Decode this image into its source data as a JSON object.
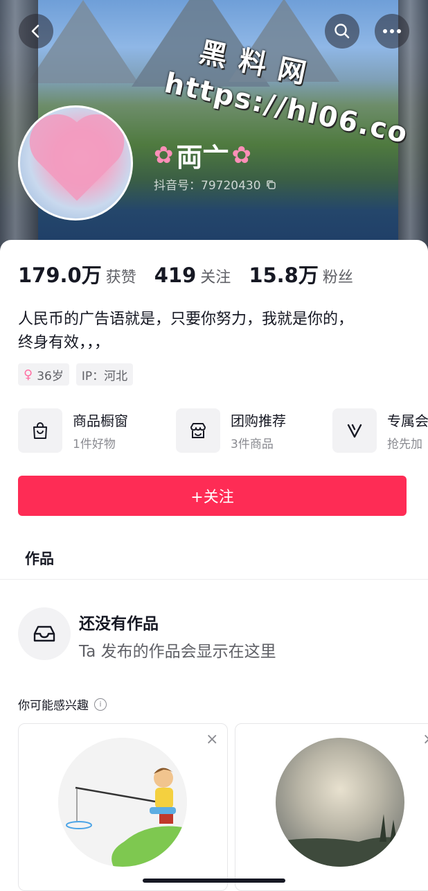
{
  "header": {
    "watermark_line1": "黑 料 网",
    "watermark_line2": "https://hl06.co",
    "nickname": "両亠",
    "douyin_id": "抖音号：79720430"
  },
  "stats": [
    {
      "value": "179.0万",
      "label": "获赞"
    },
    {
      "value": "419",
      "label": "关注"
    },
    {
      "value": "15.8万",
      "label": "粉丝"
    }
  ],
  "bio": {
    "line1": "人民币的广告语就是，只要你努力，我就是你的，",
    "line2": "终身有效，，，"
  },
  "tags": {
    "age": "36岁",
    "ip": "IP：河北"
  },
  "services": [
    {
      "title": "商品橱窗",
      "sub": "1件好物",
      "icon": "shopping-bag-icon"
    },
    {
      "title": "团购推荐",
      "sub": "3件商品",
      "icon": "store-icon"
    },
    {
      "title": "专属会",
      "sub": "抢先加",
      "icon": "v-badge-icon"
    }
  ],
  "follow_button": "+关注",
  "tabs": {
    "works": "作品"
  },
  "empty_state": {
    "title": "还没有作品",
    "subtitle": "Ta 发布的作品会显示在这里"
  },
  "recommend": {
    "label": "你可能感兴趣",
    "info_glyph": "i",
    "close_glyph": "×"
  },
  "colors": {
    "accent": "#fe2c55",
    "text_primary": "#161823",
    "text_secondary": "#5f6066"
  }
}
